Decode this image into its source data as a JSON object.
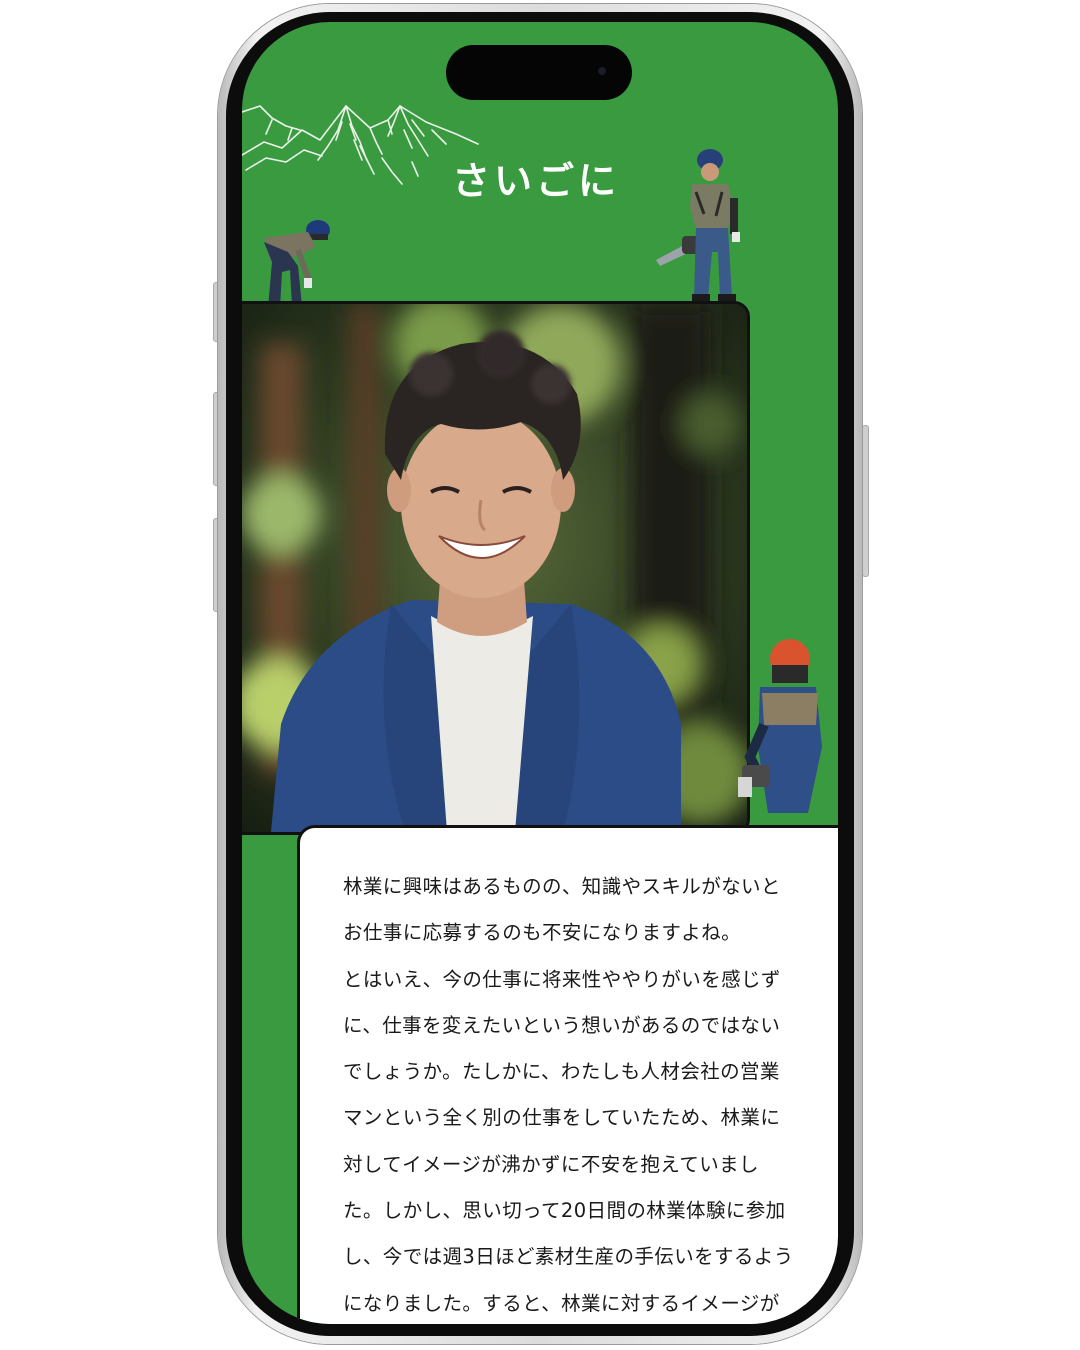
{
  "section": {
    "title": "さいごに"
  },
  "article": {
    "body": "林業に興味はあるものの、知識やスキルがないと\nお仕事に応募するのも不安になりますよね。\nとはいえ、今の仕事に将来性ややりがいを感じず\nに、仕事を変えたいという想いがあるのではない\nでしょうか。たしかに、わたしも人材会社の営業\nマンという全く別の仕事をしていたため、林業に\n対してイメージが沸かずに不安を抱えていまし\nた。しかし、思い切って20日間の林業体験に参加\nし、今では週3日ほど素材生産の手伝いをするよう\nになりました。すると、林業に対するイメージが"
  },
  "colors": {
    "background_green": "#3a9a40",
    "card_white": "#ffffff",
    "frame_border": "#111111"
  },
  "icons": [
    "mountain-illustration",
    "forestry-worker-illustration",
    "portrait-photo"
  ]
}
